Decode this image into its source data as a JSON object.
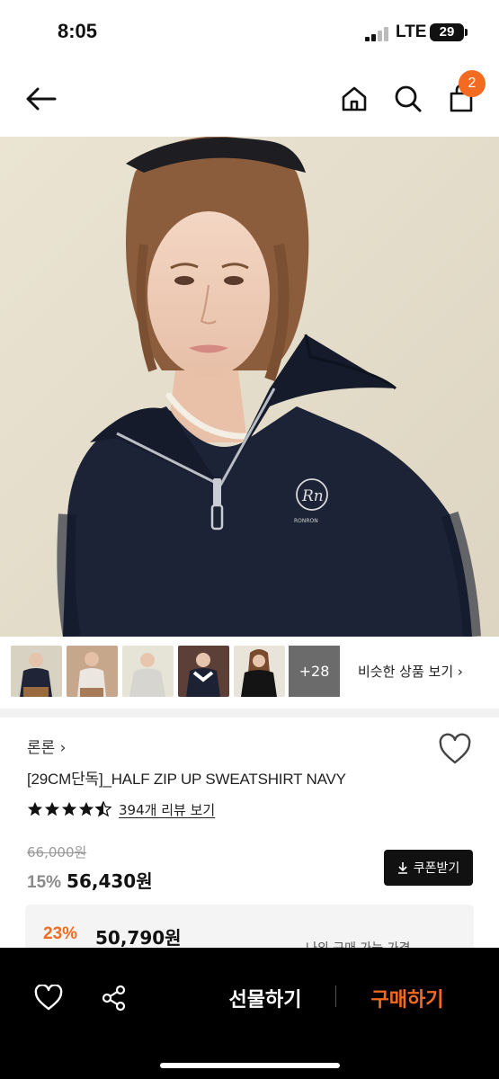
{
  "status_bar": {
    "time": "8:05",
    "network": "LTE",
    "battery": "29"
  },
  "top_nav": {
    "cart_count": "2",
    "icons": [
      "back-arrow-icon",
      "home-icon",
      "search-icon",
      "cart-icon"
    ]
  },
  "gallery": {
    "more_count": "+28",
    "similar_link": "비슷한 상품 보기 ›"
  },
  "product": {
    "brand": "론론 ›",
    "title": "[29CM단독]_HALF ZIP UP SWEATSHIRT NAVY",
    "rating": 4.5,
    "review_link": "394개 리뷰 보기",
    "original_price": "66,000원",
    "discount": "15%",
    "price": "56,430원",
    "coupon_label": "쿠폰받기",
    "logo_text": "RONRON"
  },
  "best_price": {
    "discount": "23%",
    "price": "50,790원",
    "label": "나의 구매 가능 가격 ⌄"
  },
  "bottom_bar": {
    "gift_label": "선물하기",
    "buy_label": "구매하기"
  },
  "colors": {
    "accent": "#f26b21",
    "navy": "#1b2235",
    "background": "#ffffff"
  }
}
